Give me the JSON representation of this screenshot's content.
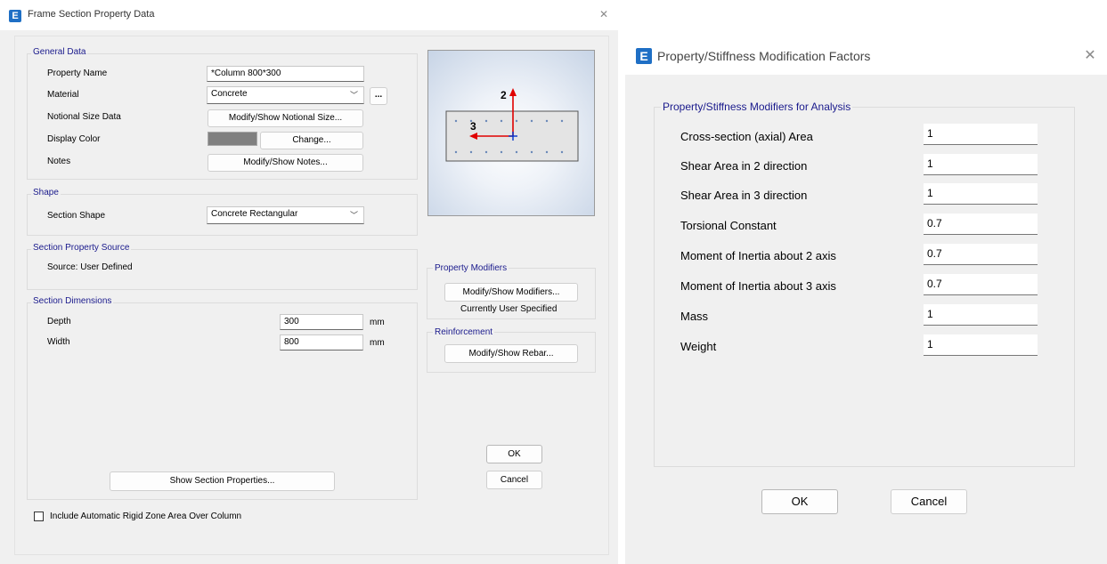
{
  "dialog1": {
    "title": "Frame Section Property Data",
    "app_icon": "E",
    "close_glyph": "✕",
    "general": {
      "legend": "General Data",
      "property_name_label": "Property Name",
      "property_name_value": "*Column 800*300",
      "material_label": "Material",
      "material_value": "Concrete",
      "material_more": "...",
      "notional_label": "Notional Size Data",
      "notional_button": "Modify/Show Notional Size...",
      "display_color_label": "Display Color",
      "display_color_swatch": "#808080",
      "change_button": "Change...",
      "notes_label": "Notes",
      "notes_button": "Modify/Show Notes..."
    },
    "shape": {
      "legend": "Shape",
      "section_shape_label": "Section Shape",
      "section_shape_value": "Concrete Rectangular"
    },
    "source": {
      "legend": "Section Property Source",
      "source_text": "Source:  User Defined"
    },
    "dimensions": {
      "legend": "Section Dimensions",
      "depth_label": "Depth",
      "depth_value": "300",
      "depth_unit": "mm",
      "width_label": "Width",
      "width_value": "800",
      "width_unit": "mm",
      "show_props_button": "Show Section Properties..."
    },
    "preview": {
      "axis2": "2",
      "axis3": "3"
    },
    "modifiers": {
      "legend": "Property Modifiers",
      "button": "Modify/Show Modifiers...",
      "status": "Currently User Specified"
    },
    "reinforcement": {
      "legend": "Reinforcement",
      "button": "Modify/Show Rebar..."
    },
    "ok_button": "OK",
    "cancel_button": "Cancel",
    "rigid_zone_label": "Include Automatic Rigid Zone Area Over Column",
    "rigid_zone_checked": false
  },
  "dialog2": {
    "title": "Property/Stiffness Modification Factors",
    "app_icon": "E",
    "close_glyph": "✕",
    "legend": "Property/Stiffness Modifiers for Analysis",
    "rows": [
      {
        "label": "Cross-section (axial) Area",
        "value": "1"
      },
      {
        "label": "Shear Area in 2 direction",
        "value": "1"
      },
      {
        "label": "Shear Area in 3 direction",
        "value": "1"
      },
      {
        "label": "Torsional Constant",
        "value": "0.7"
      },
      {
        "label": "Moment of Inertia about 2 axis",
        "value": "0.7"
      },
      {
        "label": "Moment of Inertia about 3 axis",
        "value": "0.7"
      },
      {
        "label": "Mass",
        "value": "1"
      },
      {
        "label": "Weight",
        "value": "1"
      }
    ],
    "ok_button": "OK",
    "cancel_button": "Cancel"
  },
  "colors": {
    "accent_blue": "#1f6fc5",
    "group_label_blue": "#1a1a8c",
    "axis_red": "#e00000",
    "axis_blue": "#0033cc"
  }
}
